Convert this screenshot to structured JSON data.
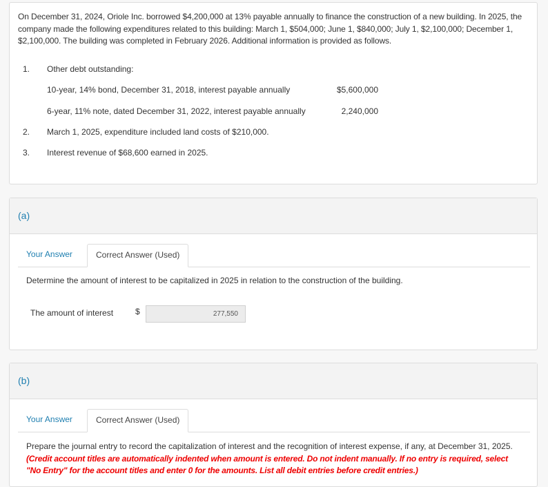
{
  "problem": {
    "intro": "On December 31, 2024, Oriole Inc. borrowed $4,200,000 at 13% payable annually to finance the construction of a new building. In 2025, the company made the following expenditures related to this building: March 1, $504,000; June 1, $840,000; July 1, $2,100,000; December 1, $2,100,000. The building was completed in February 2026. Additional information is provided as follows.",
    "items": [
      {
        "num": "1.",
        "text": "Other debt outstanding:"
      },
      {
        "num": "2.",
        "text": "March 1, 2025, expenditure included land costs of $210,000."
      },
      {
        "num": "3.",
        "text": "Interest revenue of $68,600 earned in 2025."
      }
    ],
    "debts": [
      {
        "text": "10-year, 14% bond, December 31, 2018, interest payable annually",
        "amount": "$5,600,000"
      },
      {
        "text": "6-year, 11% note, dated December 31, 2022, interest payable annually",
        "amount": "2,240,000"
      }
    ]
  },
  "part_a": {
    "label": "(a)",
    "tabs": {
      "your_answer": "Your Answer",
      "correct_answer": "Correct Answer (Used)"
    },
    "question": "Determine the amount of interest to be capitalized in 2025 in relation to the construction of the building.",
    "answer_label": "The amount of interest",
    "currency": "$",
    "answer_value": "277,550"
  },
  "part_b": {
    "label": "(b)",
    "tabs": {
      "your_answer": "Your Answer",
      "correct_answer": "Correct Answer (Used)"
    },
    "question": "Prepare the journal entry to record the capitalization of interest and the recognition of interest expense, if any, at December 31, 2025.",
    "instruction": "(Credit account titles are automatically indented when amount is entered. Do not indent manually. If no entry is required, select \"No Entry\" for the account titles and enter 0 for the amounts. List all debit entries before credit entries.)"
  }
}
